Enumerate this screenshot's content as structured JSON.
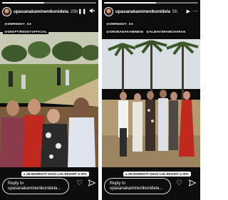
{
  "stories": [
    {
      "username": "upasanakaminenikonidela",
      "time_ago": "25h",
      "tags": [
        "@DWREDDY_SA",
        "@DEEPTIREDDYOFFICIAL"
      ],
      "location": "JW MARRIOTT KHAO LAK RESORT & SPA",
      "reply_placeholder": "Reply to upasanakaminenikonidela...",
      "progress_fraction": 0.45
    },
    {
      "username": "upasanakaminenikonidela",
      "time_ago": "5h",
      "tags": [
        "@DWREDDY_SA",
        "@SHOBANAKAMINENI",
        "@ALMAVSRAMCHARAN"
      ],
      "location": "JW MARRIOTT KHAO LAK RESORT & SPA",
      "reply_placeholder": "Reply to upasanakaminenikonidela...",
      "progress_fraction": 0.55
    }
  ],
  "icons": {
    "pause": "pause-icon",
    "mute": "speaker-mute-icon",
    "more": "more-dots-icon",
    "heart": "heart-icon",
    "send": "send-icon",
    "location_pin": "location-pin-icon"
  },
  "colors": {
    "tag_bg": "#000000",
    "story_bg": "#0c0c0c",
    "red_dress": "#c1281e"
  }
}
